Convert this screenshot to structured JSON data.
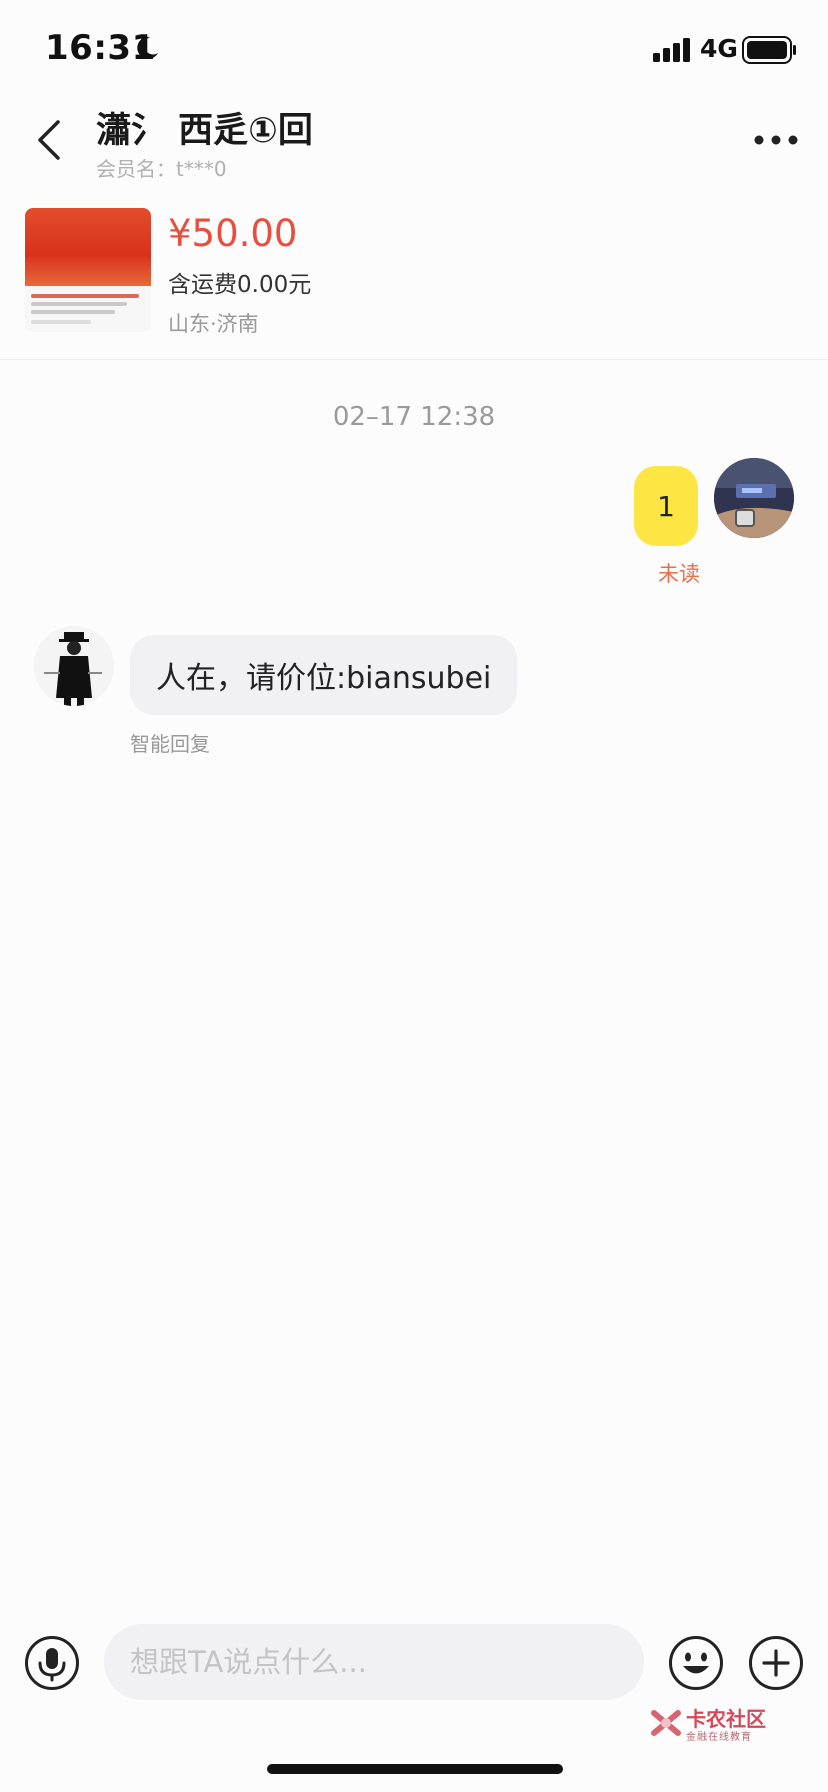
{
  "status_bar": {
    "time": "16:31",
    "network": "4G",
    "moon_icon": "moon-icon",
    "signal_icon": "cellular-signal-icon",
    "battery_icon": "battery-icon"
  },
  "header": {
    "title": "瀟氵 西辵①回",
    "member_name": "会员名：t***0",
    "back_icon": "chevron-left-icon",
    "more_icon": "more-dots-icon"
  },
  "product": {
    "price": "¥50.00",
    "shipping": "含运费0.00元",
    "location": "山东·济南"
  },
  "conversation": {
    "timestamp": "02–17 12:38",
    "messages": [
      {
        "sender": "me",
        "text": "1",
        "status": "未读"
      },
      {
        "sender": "them",
        "text": "人在，请价位:biansubei",
        "note": "智能回复"
      }
    ]
  },
  "input_bar": {
    "placeholder": "想跟TA说点什么...",
    "value": "",
    "mic_icon": "microphone-icon",
    "emoji_icon": "emoji-smile-icon",
    "plus_icon": "plus-circle-icon"
  },
  "watermark": {
    "name": "卡农社区",
    "subtitle": "金融在线教育"
  },
  "colors": {
    "price_red": "#e84d3d",
    "my_bubble_yellow": "#fde643",
    "unread_orange": "#e8704a",
    "their_bubble_gray": "#f1f1f3"
  }
}
